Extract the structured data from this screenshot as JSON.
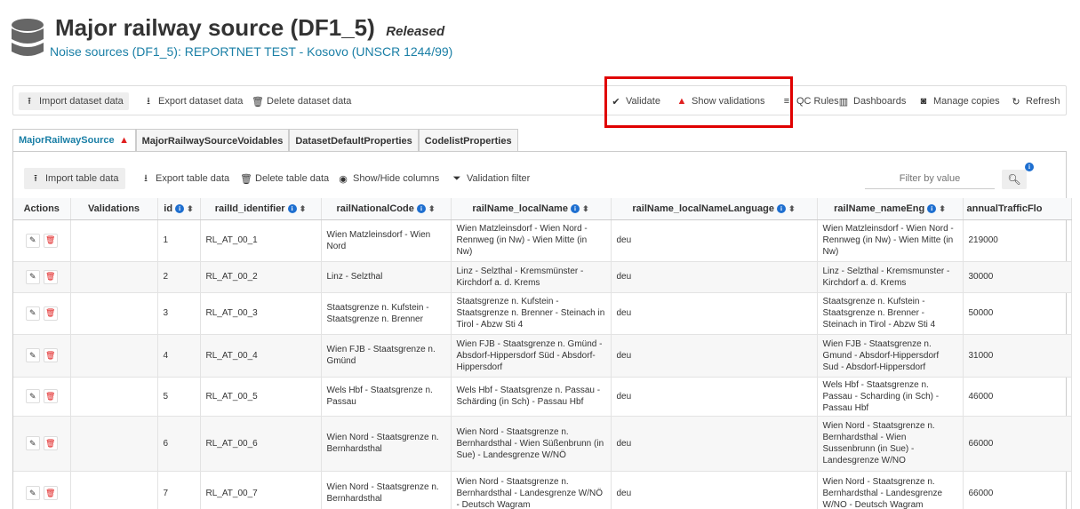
{
  "header": {
    "title": "Major railway source (DF1_5)",
    "status": "Released",
    "subtitle": "Noise sources (DF1_5): REPORTNET TEST - Kosovo (UNSCR 1244/99)"
  },
  "toolbar": {
    "import_label": "Import dataset data",
    "export_label": "Export dataset data",
    "delete_label": "Delete dataset data",
    "validate_label": "Validate",
    "show_validations_label": "Show validations",
    "qc_rules_label": "QC Rules",
    "dashboards_label": "Dashboards",
    "manage_copies_label": "Manage copies",
    "refresh_label": "Refresh"
  },
  "tabs": [
    {
      "label": "MajorRailwaySource"
    },
    {
      "label": "MajorRailwaySourceVoidables"
    },
    {
      "label": "DatasetDefaultProperties"
    },
    {
      "label": "CodelistProperties"
    }
  ],
  "table_toolbar": {
    "import_label": "Import table data",
    "export_label": "Export table data",
    "delete_label": "Delete table data",
    "columns_label": "Show/Hide columns",
    "filter_label": "Validation filter",
    "filter_placeholder": "Filter by value"
  },
  "columns": {
    "actions": "Actions",
    "validations": "Validations",
    "id": "id",
    "railId": "railId_identifier",
    "code": "railNationalCode",
    "localName": "railName_localName",
    "language": "railName_localNameLanguage",
    "nameEng": "railName_nameEng",
    "traffic": "annualTrafficFlo"
  },
  "rows": [
    {
      "id": "1",
      "railId": "RL_AT_00_1",
      "code": "Wien Matzleinsdorf - Wien Nord",
      "localName": "Wien Matzleinsdorf - Wien Nord - Rennweg (in Nw) - Wien Mitte (in Nw)",
      "language": "deu",
      "nameEng": "Wien Matzleinsdorf - Wien Nord - Rennweg (in Nw) - Wien Mitte (in Nw)",
      "traffic": "219000"
    },
    {
      "id": "2",
      "railId": "RL_AT_00_2",
      "code": "Linz - Selzthal",
      "localName": "Linz - Selzthal - Kremsmünster - Kirchdorf a. d. Krems",
      "language": "deu",
      "nameEng": "Linz - Selzthal - Kremsmunster - Kirchdorf a. d. Krems",
      "traffic": "30000"
    },
    {
      "id": "3",
      "railId": "RL_AT_00_3",
      "code": "Staatsgrenze n. Kufstein - Staatsgrenze n. Brenner",
      "localName": "Staatsgrenze n. Kufstein - Staatsgrenze n. Brenner - Steinach in Tirol - Abzw Sti 4",
      "language": "deu",
      "nameEng": "Staatsgrenze n. Kufstein - Staatsgrenze n. Brenner - Steinach in Tirol - Abzw Sti 4",
      "traffic": "50000"
    },
    {
      "id": "4",
      "railId": "RL_AT_00_4",
      "code": "Wien FJB - Staatsgrenze n. Gmünd",
      "localName": "Wien FJB - Staatsgrenze n. Gmünd - Absdorf-Hippersdorf Süd - Absdorf-Hippersdorf",
      "language": "deu",
      "nameEng": "Wien FJB - Staatsgrenze n. Gmund - Absdorf-Hippersdorf Sud - Absdorf-Hippersdorf",
      "traffic": "31000"
    },
    {
      "id": "5",
      "railId": "RL_AT_00_5",
      "code": "Wels Hbf - Staatsgrenze n. Passau",
      "localName": "Wels Hbf - Staatsgrenze n. Passau - Schärding (in Sch) - Passau Hbf",
      "language": "deu",
      "nameEng": "Wels Hbf - Staatsgrenze n. Passau - Scharding (in Sch) - Passau Hbf",
      "traffic": "46000"
    },
    {
      "id": "6",
      "railId": "RL_AT_00_6",
      "code": "Wien Nord - Staatsgrenze n. Bernhardsthal",
      "localName": "Wien Nord - Staatsgrenze n. Bernhardsthal - Wien Süßenbrunn (in Sue) - Landesgrenze W/NÖ",
      "language": "deu",
      "nameEng": "Wien Nord - Staatsgrenze n. Bernhardsthal - Wien Sussenbrunn (in Sue) - Landesgrenze W/NO",
      "traffic": "66000"
    },
    {
      "id": "7",
      "railId": "RL_AT_00_7",
      "code": "Wien Nord - Staatsgrenze n. Bernhardsthal",
      "localName": "Wien Nord - Staatsgrenze n. Bernhardsthal - Landesgrenze W/NÖ - Deutsch Wagram",
      "language": "deu",
      "nameEng": "Wien Nord - Staatsgrenze n. Bernhardsthal - Landesgrenze W/NO - Deutsch Wagram",
      "traffic": "66000"
    }
  ]
}
